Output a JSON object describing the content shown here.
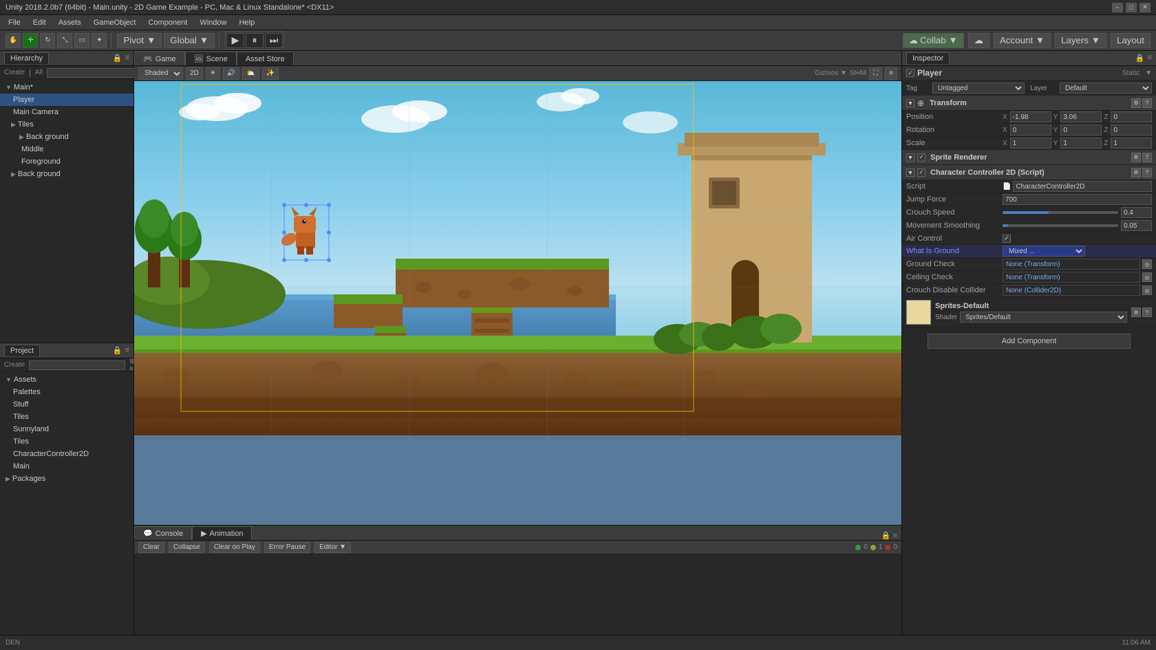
{
  "titlebar": {
    "title": "Unity 2018.2.0b7 (64bit) - Main.unity - 2D Game Example - PC, Mac & Linux Standalone* <DX11>"
  },
  "menubar": {
    "items": [
      "File",
      "Edit",
      "Assets",
      "GameObject",
      "Component",
      "Window",
      "Help"
    ]
  },
  "toolbar": {
    "pivot_label": "Pivot",
    "global_label": "Global",
    "collab_label": "Collab ▼",
    "account_label": "Account ▼",
    "layers_label": "Layers ▼",
    "layout_label": "Layout"
  },
  "hierarchy": {
    "title": "Hierarchy",
    "create_label": "Create",
    "all_label": "All",
    "items": [
      {
        "label": "Main*",
        "indent": 0,
        "arrow": "▼"
      },
      {
        "label": "Player",
        "indent": 1,
        "arrow": "",
        "selected": true
      },
      {
        "label": "Main Camera",
        "indent": 1,
        "arrow": ""
      },
      {
        "label": "Tiles",
        "indent": 1,
        "arrow": "▶"
      },
      {
        "label": "Background",
        "indent": 2,
        "arrow": "▶"
      },
      {
        "label": "Middle",
        "indent": 2,
        "arrow": ""
      },
      {
        "label": "Foreground",
        "indent": 2,
        "arrow": ""
      },
      {
        "label": "Background",
        "indent": 1,
        "arrow": "▶"
      }
    ]
  },
  "scene_view": {
    "tabs": [
      "Game",
      "Scene",
      "Asset Store"
    ],
    "active_tab": "Game",
    "shaded_label": "Shaded",
    "mode_label": "2D",
    "gizmos_label": "Gizmos ▼"
  },
  "inspector": {
    "title": "Inspector",
    "player_label": "Player",
    "static_label": "Static",
    "tag_label": "Tag",
    "tag_value": "Untagged",
    "layer_label": "Layer",
    "layer_value": "Default",
    "transform": {
      "title": "Transform",
      "position": {
        "label": "Position",
        "x": "-1.98",
        "y": "3.06",
        "z": "0"
      },
      "rotation": {
        "label": "Rotation",
        "x": "0",
        "y": "0",
        "z": "0"
      },
      "scale": {
        "label": "Scale",
        "x": "1",
        "y": "1",
        "z": "1"
      }
    },
    "sprite_renderer": {
      "title": "Sprite Renderer"
    },
    "character_controller": {
      "title": "Character Controller 2D (Script)",
      "script_label": "Script",
      "script_value": "CharacterController2D",
      "jump_force_label": "Jump Force",
      "jump_force_value": "700",
      "crouch_speed_label": "Crouch Speed",
      "crouch_speed_value": "0.4",
      "movement_smoothing_label": "Movement Smoothing",
      "movement_smoothing_value": "0.05",
      "air_control_label": "Air Control",
      "what_is_ground_label": "What Is Ground",
      "what_is_ground_value": "Mixed ...",
      "ground_check_label": "Ground Check",
      "ground_check_value": "None (Transform)",
      "ceiling_check_label": "Ceiling Check",
      "ceiling_check_value": "None (Transform)",
      "crouch_disable_label": "Crouch Disable Collider",
      "crouch_disable_value": "None (Collider2D)"
    },
    "sprites_default": {
      "title": "Sprites-Default",
      "shader_label": "Shader",
      "shader_value": "Sprites/Default"
    },
    "add_component_label": "Add Component"
  },
  "project": {
    "title": "Project",
    "create_label": "Create",
    "assets_label": "Assets",
    "items": [
      "Palettes",
      "Stuff",
      "Tiles",
      "Sunnyland",
      "Tiles",
      "CharacterController2D",
      "Main",
      "Packages"
    ]
  },
  "console": {
    "tabs": [
      "Console",
      "Animation"
    ],
    "active_tab": "Console",
    "clear_label": "Clear",
    "collapse_label": "Collapse",
    "clear_on_play_label": "Clear on Play",
    "error_pause_label": "Error Pause",
    "editor_label": "Editor ▼"
  },
  "statusbar": {
    "text": ""
  },
  "icons": {
    "play": "▶",
    "pause": "⏸",
    "step": "⏭",
    "arrow_right": "▶",
    "arrow_down": "▼",
    "lock": "🔒",
    "eye": "👁",
    "gear": "⚙",
    "transform": "⊕",
    "plus": "+",
    "minus": "−",
    "close": "✕",
    "maximize": "□",
    "minimize": "−"
  }
}
